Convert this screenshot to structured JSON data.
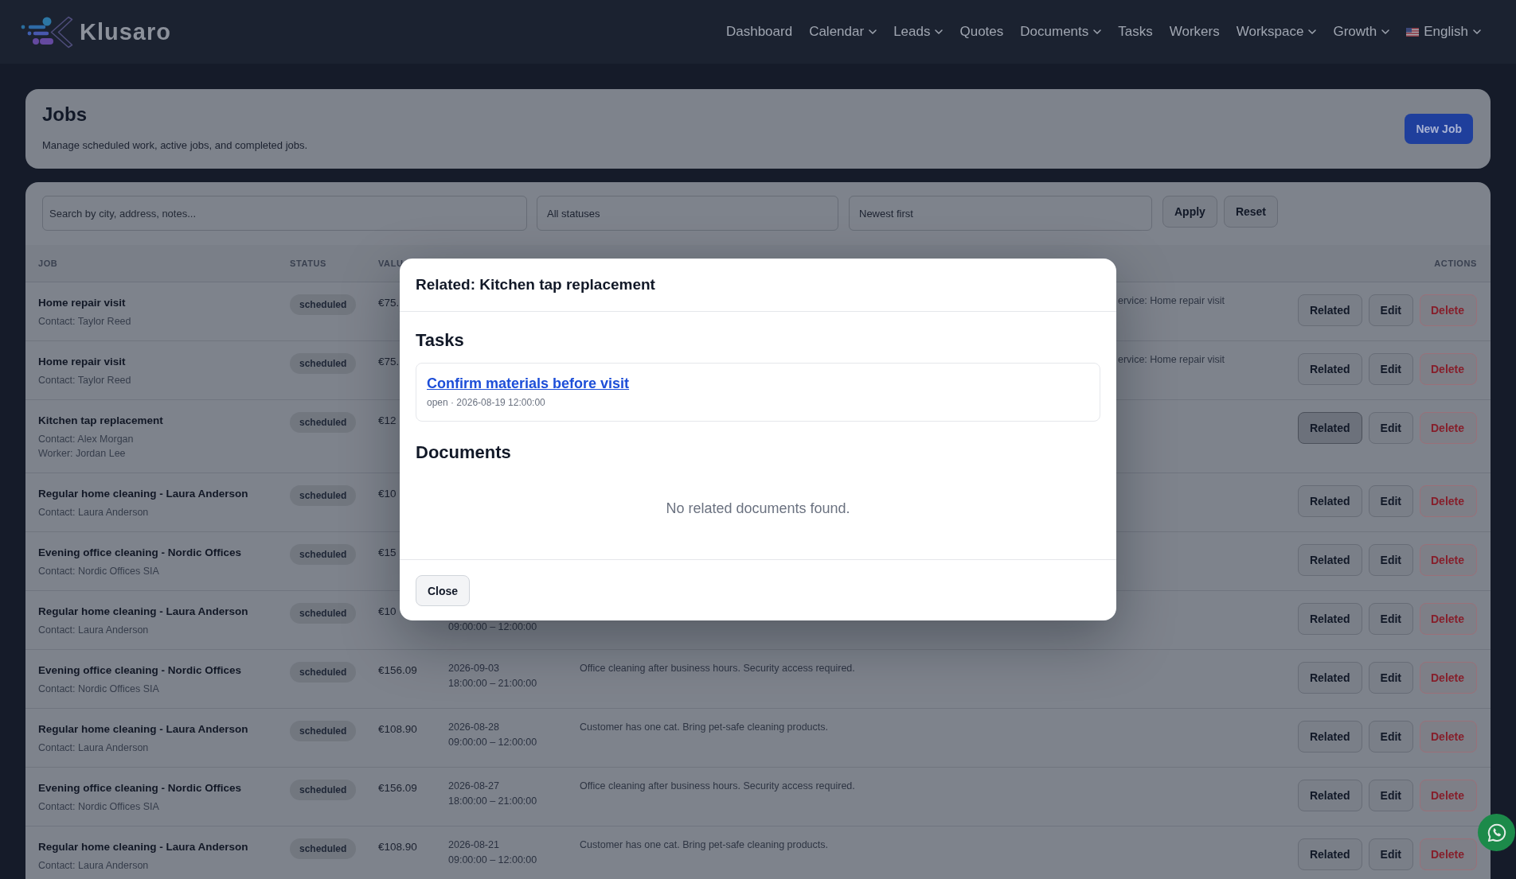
{
  "header": {
    "brand": "Klusaro",
    "nav": [
      {
        "label": "Dashboard",
        "has_menu": false
      },
      {
        "label": "Calendar",
        "has_menu": true
      },
      {
        "label": "Leads",
        "has_menu": true
      },
      {
        "label": "Quotes",
        "has_menu": false
      },
      {
        "label": "Documents",
        "has_menu": true
      },
      {
        "label": "Tasks",
        "has_menu": false
      },
      {
        "label": "Workers",
        "has_menu": false
      },
      {
        "label": "Workspace",
        "has_menu": true
      },
      {
        "label": "Growth",
        "has_menu": true
      }
    ],
    "language": {
      "label": "English",
      "has_menu": true
    }
  },
  "page_header": {
    "title": "Jobs",
    "subtitle": "Manage scheduled work, active jobs, and completed jobs.",
    "new_button": "New Job"
  },
  "filters": {
    "search": {
      "placeholder": "Search by city, address, notes..."
    },
    "status": {
      "value": "All statuses"
    },
    "sort": {
      "value": "Newest first"
    },
    "buttons": [
      "Apply",
      "Reset"
    ]
  },
  "table": {
    "columns": {
      "job": "JOB",
      "status": "STATUS",
      "value": "VALU",
      "actions": "ACTIONS"
    },
    "rows": [
      {
        "title": "Home repair visit",
        "contact": "Contact: Taylor Reed",
        "status": "scheduled",
        "value": "€75.",
        "notes": "ervice: Home repair visit",
        "notes_cut": true,
        "selected": false,
        "actions": [
          {
            "label": "Related",
            "kind": "related"
          },
          {
            "label": "Edit",
            "kind": "edit"
          },
          {
            "label": "Delete",
            "kind": "delete"
          }
        ]
      },
      {
        "title": "Home repair visit",
        "contact": "Contact: Taylor Reed",
        "status": "scheduled",
        "value": "€75.",
        "notes": "ervice: Home repair visit",
        "notes_cut": true,
        "selected": false,
        "actions": [
          {
            "label": "Related",
            "kind": "related"
          },
          {
            "label": "Edit",
            "kind": "edit"
          },
          {
            "label": "Delete",
            "kind": "delete"
          }
        ]
      },
      {
        "title": "Kitchen tap replacement",
        "contact": "Contact: Alex Morgan",
        "worker": "Worker: Jordan Lee",
        "status": "scheduled",
        "value": "€12",
        "selected": true,
        "actions": [
          {
            "label": "Related",
            "kind": "related"
          },
          {
            "label": "Edit",
            "kind": "edit"
          },
          {
            "label": "Delete",
            "kind": "delete"
          }
        ]
      },
      {
        "title": "Regular home cleaning - Laura Anderson",
        "contact": "Contact: Laura Anderson",
        "status": "scheduled",
        "value": "€10",
        "selected": false,
        "actions": [
          {
            "label": "Related",
            "kind": "related"
          },
          {
            "label": "Edit",
            "kind": "edit"
          },
          {
            "label": "Delete",
            "kind": "delete"
          }
        ]
      },
      {
        "title": "Evening office cleaning - Nordic Offices",
        "contact": "Contact: Nordic Offices SIA",
        "status": "scheduled",
        "value": "€15",
        "selected": false,
        "actions": [
          {
            "label": "Related",
            "kind": "related"
          },
          {
            "label": "Edit",
            "kind": "edit"
          },
          {
            "label": "Delete",
            "kind": "delete"
          }
        ]
      },
      {
        "title": "Regular home cleaning - Laura Anderson",
        "contact": "Contact: Laura Anderson",
        "status": "scheduled",
        "value": "€10",
        "time": "09:00:00 – 12:00:00",
        "selected": false,
        "actions": [
          {
            "label": "Related",
            "kind": "related"
          },
          {
            "label": "Edit",
            "kind": "edit"
          },
          {
            "label": "Delete",
            "kind": "delete"
          }
        ]
      },
      {
        "title": "Evening office cleaning - Nordic Offices",
        "contact": "Contact: Nordic Offices SIA",
        "status": "scheduled",
        "value": "€156.09",
        "date": "2026-09-03",
        "time": "18:00:00 – 21:00:00",
        "notes": "Office cleaning after business hours. Security access required.",
        "notes_cut": false,
        "selected": false,
        "actions": [
          {
            "label": "Related",
            "kind": "related"
          },
          {
            "label": "Edit",
            "kind": "edit"
          },
          {
            "label": "Delete",
            "kind": "delete"
          }
        ]
      },
      {
        "title": "Regular home cleaning - Laura Anderson",
        "contact": "Contact: Laura Anderson",
        "status": "scheduled",
        "value": "€108.90",
        "date": "2026-08-28",
        "time": "09:00:00 – 12:00:00",
        "notes": "Customer has one cat. Bring pet-safe cleaning products.",
        "notes_cut": false,
        "selected": false,
        "actions": [
          {
            "label": "Related",
            "kind": "related"
          },
          {
            "label": "Edit",
            "kind": "edit"
          },
          {
            "label": "Delete",
            "kind": "delete"
          }
        ]
      },
      {
        "title": "Evening office cleaning - Nordic Offices",
        "contact": "Contact: Nordic Offices SIA",
        "status": "scheduled",
        "value": "€156.09",
        "date": "2026-08-27",
        "time": "18:00:00 – 21:00:00",
        "notes": "Office cleaning after business hours. Security access required.",
        "notes_cut": false,
        "selected": false,
        "actions": [
          {
            "label": "Related",
            "kind": "related"
          },
          {
            "label": "Edit",
            "kind": "edit"
          },
          {
            "label": "Delete",
            "kind": "delete"
          }
        ]
      },
      {
        "title": "Regular home cleaning - Laura Anderson",
        "contact": "Contact: Laura Anderson",
        "status": "scheduled",
        "value": "€108.90",
        "date": "2026-08-21",
        "time": "09:00:00 – 12:00:00",
        "notes": "Customer has one cat. Bring pet-safe cleaning products.",
        "notes_cut": false,
        "selected": false,
        "actions": [
          {
            "label": "Related",
            "kind": "related"
          },
          {
            "label": "Edit",
            "kind": "edit"
          },
          {
            "label": "Delete",
            "kind": "delete"
          }
        ]
      }
    ]
  },
  "dialog": {
    "title": "Related: Kitchen tap replacement",
    "sections": [
      {
        "heading": "Tasks",
        "items": [
          {
            "title": "Confirm materials before visit",
            "meta": "open · 2026-08-19 12:00:00"
          }
        ]
      },
      {
        "heading": "Documents",
        "empty_text": "No related documents found."
      }
    ],
    "close_button": "Close"
  }
}
